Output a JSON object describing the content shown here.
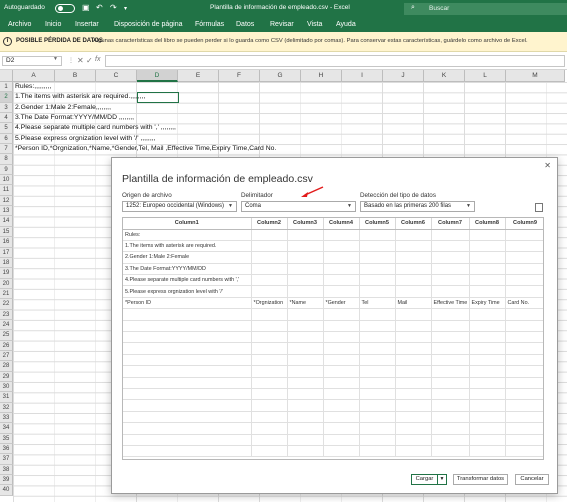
{
  "titlebar": {
    "autosave_label": "Autoguardado",
    "doc_title": "Plantilla de información de empleado.csv  -  Excel",
    "search_placeholder": "Buscar"
  },
  "menu": [
    "Archivo",
    "Inicio",
    "Insertar",
    "Disposición de página",
    "Fórmulas",
    "Datos",
    "Revisar",
    "Vista",
    "Ayuda"
  ],
  "warning": {
    "title": "POSIBLE PÉRDIDA DE DATOS",
    "text": "Algunas características del libro se pueden perder si lo guarda como CSV (delimitado por comas). Para conservar estas características, guárdelo como archivo de Excel."
  },
  "formula_bar": {
    "name_box": "D2",
    "content": ""
  },
  "grid": {
    "columns": [
      "A",
      "B",
      "C",
      "D",
      "E",
      "F",
      "G",
      "H",
      "I",
      "J",
      "K",
      "L",
      "M"
    ],
    "selected_column": "D",
    "selected_row": "2",
    "rows": [
      "1",
      "2",
      "3",
      "4",
      "5",
      "6",
      "7",
      "8",
      "9",
      "10",
      "11",
      "12",
      "13",
      "14",
      "15",
      "16",
      "17",
      "18",
      "19",
      "20",
      "21",
      "22",
      "23",
      "24",
      "25",
      "26",
      "27",
      "28",
      "29",
      "30",
      "31",
      "32",
      "33",
      "34",
      "35",
      "36",
      "37",
      "38",
      "39",
      "40"
    ],
    "cells": [
      "Rules:,,,,,,,,,",
      "1.The items with asterisk are required.,,,,,,,,",
      "2.Gender 1:Male 2:Female,,,,,,,,",
      "3.The Date Format:YYYY/MM/DD          ,,,,,,,,",
      "4.Please separate multiple card numbers with ',' ,,,,,,,,",
      "5.Please express orgnization level with '/'      ,,,,,,,,",
      "*Person ID,*Orgnization,*Name,*Gender,Tel, Mail ,Effective Time,Expiry Time,Card No."
    ]
  },
  "dialog": {
    "title": "Plantilla de información de empleado.csv",
    "origin_label": "Origen de archivo",
    "origin_value": "1252: Europeo occidental (Windows)",
    "delimiter_label": "Delimitador",
    "delimiter_value": "Coma",
    "detect_label": "Detección del tipo de datos",
    "detect_value": "Basado en las primeras 200 filas",
    "preview_headers": [
      "Column1",
      "Column2",
      "Column3",
      "Column4",
      "Column5",
      "Column6",
      "Column7",
      "Column8",
      "Column9"
    ],
    "preview_rows": [
      [
        "Rules:",
        "",
        "",
        "",
        "",
        "",
        "",
        "",
        ""
      ],
      [
        "1.The items with asterisk are required.",
        "",
        "",
        "",
        "",
        "",
        "",
        "",
        ""
      ],
      [
        "2.Gender 1:Male 2:Female",
        "",
        "",
        "",
        "",
        "",
        "",
        "",
        ""
      ],
      [
        "3.The Date Format:YYYY/MM/DD",
        "",
        "",
        "",
        "",
        "",
        "",
        "",
        ""
      ],
      [
        "4.Please separate multiple card numbers with ','",
        "",
        "",
        "",
        "",
        "",
        "",
        "",
        ""
      ],
      [
        "5.Please express orgnization level with '/'",
        "",
        "",
        "",
        "",
        "",
        "",
        "",
        ""
      ],
      [
        "*Person ID",
        "*Orgnization",
        "*Name",
        "*Gender",
        "Tel",
        "Mail",
        "Effective Time",
        "Expiry Time",
        "Card No."
      ]
    ],
    "load_button": "Cargar",
    "transform_button": "Transformar datos",
    "cancel_button": "Cancelar"
  },
  "colors": {
    "excel_green": "#217346",
    "warning_bg": "#fff4ce",
    "arrow_red": "#e21b1b"
  }
}
